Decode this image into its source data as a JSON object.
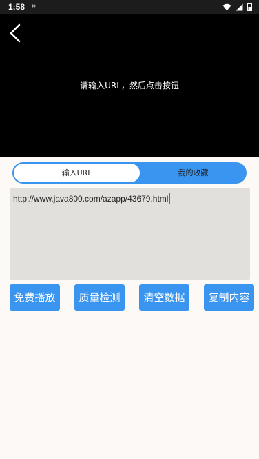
{
  "status_bar": {
    "time": "1:58",
    "left_icon": "sim-card-icon",
    "right_icons": [
      "wifi-icon",
      "signal-icon",
      "battery-icon"
    ]
  },
  "video": {
    "back_icon": "chevron-left-icon",
    "hint": "请输入URL，然后点击按钮"
  },
  "tabs": {
    "input_url_label": "输入URL",
    "favorites_label": "我的收藏"
  },
  "url_input": {
    "value": "http://www.java800.com/azapp/43679.html"
  },
  "buttons": {
    "free_play": "免费播放",
    "quality_check": "质量检测",
    "clear_data": "清空数据",
    "copy_content": "复制内容"
  },
  "colors": {
    "accent": "#3a95f0",
    "video_background": "#000000",
    "input_background": "#e2e0dd",
    "page_background": "#fcf9f6"
  }
}
